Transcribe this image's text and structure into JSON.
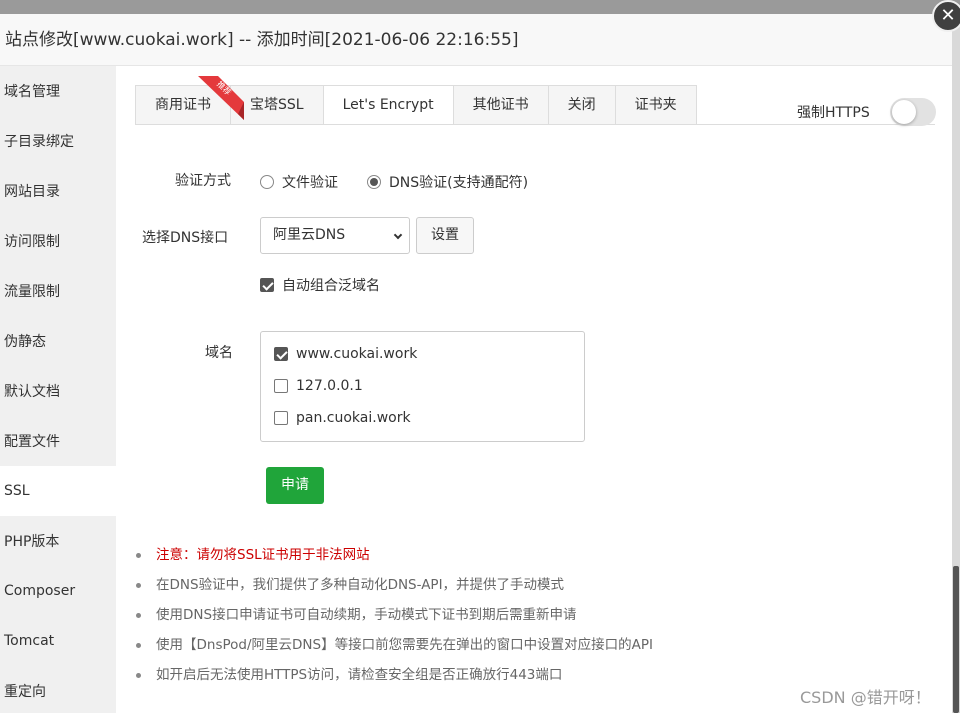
{
  "dialog": {
    "title": "站点修改[www.cuokai.work] -- 添加时间[2021-06-06 22:16:55]",
    "close_glyph": "✕"
  },
  "sidebar": {
    "items": [
      {
        "label": "域名管理"
      },
      {
        "label": "子目录绑定"
      },
      {
        "label": "网站目录"
      },
      {
        "label": "访问限制"
      },
      {
        "label": "流量限制"
      },
      {
        "label": "伪静态"
      },
      {
        "label": "默认文档"
      },
      {
        "label": "配置文件"
      },
      {
        "label": "SSL"
      },
      {
        "label": "PHP版本"
      },
      {
        "label": "Composer"
      },
      {
        "label": "Tomcat"
      },
      {
        "label": "重定向"
      }
    ],
    "active": "SSL"
  },
  "tabs": {
    "items": [
      {
        "label": "商用证书"
      },
      {
        "label": "宝塔SSL"
      },
      {
        "label": "Let's Encrypt"
      },
      {
        "label": "其他证书"
      },
      {
        "label": "关闭"
      },
      {
        "label": "证书夹"
      }
    ],
    "active": "Let's Encrypt",
    "badge": "推荐",
    "badge_color": "#e4393c"
  },
  "force_https": {
    "label": "强制HTTPS",
    "enabled": false
  },
  "verify": {
    "label": "验证方式",
    "options": [
      {
        "label": "文件验证",
        "checked": false
      },
      {
        "label": "DNS验证(支持通配符)",
        "checked": true
      }
    ]
  },
  "dns": {
    "label": "选择DNS接口",
    "selected": "阿里云DNS",
    "settings_label": "设置"
  },
  "wildcard": {
    "label": "自动组合泛域名",
    "checked": true
  },
  "domains": {
    "label": "域名",
    "items": [
      {
        "name": "www.cuokai.work",
        "checked": true
      },
      {
        "name": "127.0.0.1",
        "checked": false
      },
      {
        "name": "pan.cuokai.work",
        "checked": false
      }
    ]
  },
  "apply_label": "申请",
  "colors": {
    "accent": "#20a53a",
    "warning": "#cc0000"
  },
  "notes": [
    "注意：请勿将SSL证书用于非法网站",
    "在DNS验证中，我们提供了多种自动化DNS-API，并提供了手动模式",
    "使用DNS接口申请证书可自动续期，手动模式下证书到期后需重新申请",
    "使用【DnsPod/阿里云DNS】等接口前您需要先在弹出的窗口中设置对应接口的API",
    "如开启后无法使用HTTPS访问，请检查安全组是否正确放行443端口"
  ],
  "watermark": "CSDN @错开呀！"
}
